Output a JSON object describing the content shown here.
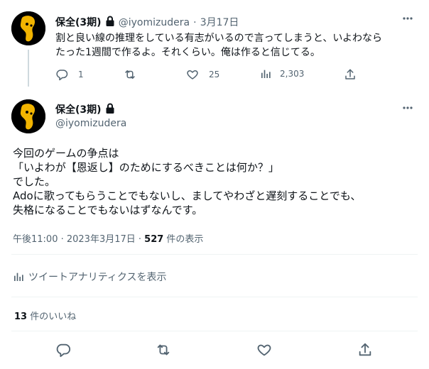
{
  "reply_tweet": {
    "display_name": "保全(3期)",
    "handle": "@iyomizudera",
    "separator": "·",
    "date": "3月17日",
    "text_line1": "割と良い線の推理をしている有志がいるので言ってしまうと、いよわなら",
    "text_line2": "たった1週間で作るよ。それくらい。俺は作ると信じてる。",
    "reply_count": "1",
    "like_count": "25",
    "view_count": "2,303"
  },
  "main_tweet": {
    "display_name": "保全(3期)",
    "handle": "@iyomizudera",
    "lines": [
      "今回のゲームの争点は",
      "「いよわが【恩返し】のためにするべきことは何か？」",
      "でした。",
      "Adoに歌ってもらうことでもないし、ましてやわざと遅刻することでも、",
      "失格になることでもないはずなんです。"
    ],
    "timestamp": "午後11:00 · 2023年3月17日 · ",
    "view_count": "527",
    "view_suffix": " 件の表示",
    "analytics_label": "ツイートアナリティクスを表示",
    "likes_count": "13",
    "likes_suffix": " 件のいいね"
  },
  "icons": {
    "reply": "reply-icon",
    "retweet": "retweet-icon",
    "like": "heart-icon",
    "views": "bar-chart-icon",
    "share": "share-icon",
    "lock": "lock-icon",
    "more": "more-icon"
  },
  "colors": {
    "text": "#0f1419",
    "secondary": "#536471",
    "thread_line": "#cfd9de",
    "divider": "#eff3f4"
  }
}
